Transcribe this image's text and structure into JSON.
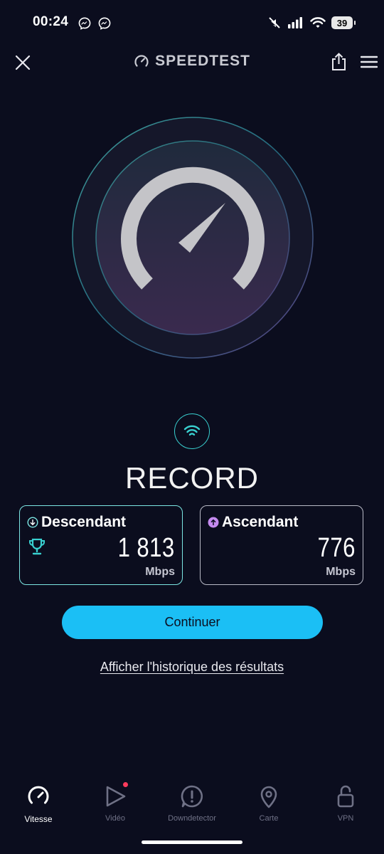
{
  "status_bar": {
    "time": "00:24",
    "battery": "39"
  },
  "header": {
    "title": "SPEEDTEST"
  },
  "result": {
    "headline": "RECORD",
    "download": {
      "label": "Descendant",
      "value": "1 813",
      "unit": "Mbps"
    },
    "upload": {
      "label": "Ascendant",
      "value": "776",
      "unit": "Mbps"
    }
  },
  "actions": {
    "continue_label": "Continuer",
    "history_label": "Afficher l'historique des résultats"
  },
  "bottom_nav": {
    "items": [
      {
        "label": "Vitesse",
        "icon": "speedometer-icon",
        "active": true
      },
      {
        "label": "Vidéo",
        "icon": "play-icon",
        "active": false
      },
      {
        "label": "Downdetector",
        "icon": "alert-icon",
        "active": false
      },
      {
        "label": "Carte",
        "icon": "map-pin-icon",
        "active": false
      },
      {
        "label": "VPN",
        "icon": "unlock-icon",
        "active": false
      }
    ]
  },
  "colors": {
    "background": "#0b0d1e",
    "accent_cyan": "#1bbff5",
    "download_border": "#7ce6e3",
    "upload_icon": "#c58bf0",
    "notification_dot": "#ff3b5c"
  }
}
